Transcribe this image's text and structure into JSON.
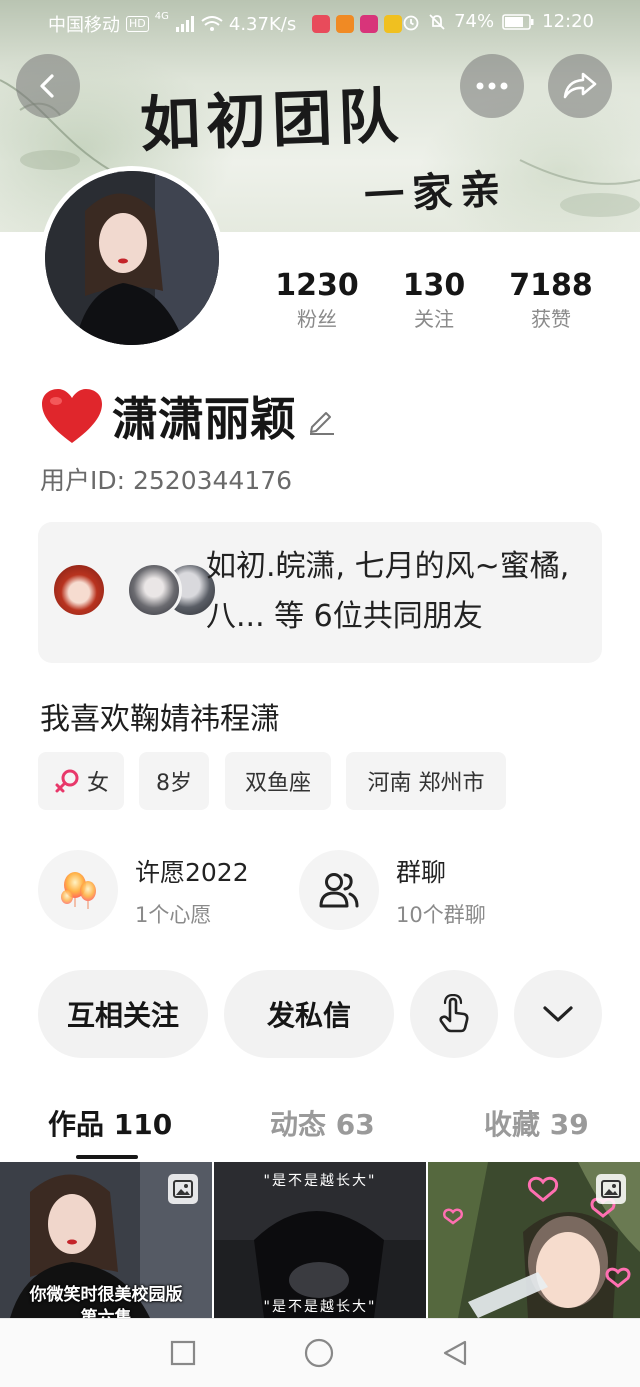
{
  "status_bar": {
    "carrier": "中国移动",
    "hd": "HD",
    "network": "4G",
    "speed": "4.37K/s",
    "battery": "74%",
    "time": "12:20"
  },
  "banner": {
    "title": "如初团队",
    "subtitle": "一家亲"
  },
  "stats": [
    {
      "value": "1230",
      "label": "粉丝"
    },
    {
      "value": "130",
      "label": "关注"
    },
    {
      "value": "7188",
      "label": "获赞"
    }
  ],
  "profile": {
    "name": "潇潇丽颖",
    "user_id": "用户ID: 2520344176",
    "bio": "我喜欢鞠婧祎程潇"
  },
  "friends": {
    "text": "如初.皖潇, 七月的风~蜜橘, 八... 等 6位共同朋友"
  },
  "tags": [
    "女",
    "8岁",
    "双鱼座",
    "河南 郑州市"
  ],
  "entries": [
    {
      "title": "许愿2022",
      "sub": "1个心愿"
    },
    {
      "title": "群聊",
      "sub": "10个群聊"
    }
  ],
  "actions": {
    "mutual_follow": "互相关注",
    "message": "发私信"
  },
  "tabs": [
    {
      "label": "作品 110"
    },
    {
      "label": "动态 63"
    },
    {
      "label": "收藏 39"
    }
  ],
  "grid": [
    {
      "caption_line1": "你微笑时很美校园版",
      "caption_line2": "第六集"
    },
    {
      "caption_top": "\"是不是越长大\"",
      "caption_bottom": "\"是不是越长大\""
    },
    {}
  ],
  "colors": {
    "heart": "#e0262c",
    "gender_icon": "#e8386a",
    "text_primary": "#161616",
    "text_secondary": "#8a8a8a",
    "chip_bg": "#f4f4f4"
  }
}
